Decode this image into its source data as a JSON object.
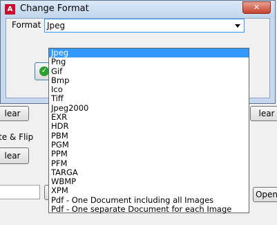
{
  "background": {
    "clear_left_label": "lear",
    "clear_right_label": "lear",
    "rotate_flip_label": "te & Flip",
    "clear_button2_label": "lear",
    "open_button_label": "Open"
  },
  "dialog": {
    "title": "Change Format",
    "close_label": "✕",
    "app_icon_glyph": "A",
    "format_label": "Format :",
    "selected_value": "Jpeg",
    "ok_icon_glyph": "✓"
  },
  "dropdown": {
    "items": [
      "Jpeg",
      "Png",
      "Gif",
      "Bmp",
      "Ico",
      "Tiff",
      "Jpeg2000",
      "EXR",
      "HDR",
      "PBM",
      "PGM",
      "PPM",
      "PFM",
      "TARGA",
      "WBMP",
      "XPM",
      "Pdf - One Document including all Images",
      "Pdf - One separate Document for each Image"
    ],
    "selected_index": 0
  },
  "colors": {
    "title_bar": "#c2d6ec",
    "selection": "#3399ff",
    "close_button": "#c7432c"
  }
}
